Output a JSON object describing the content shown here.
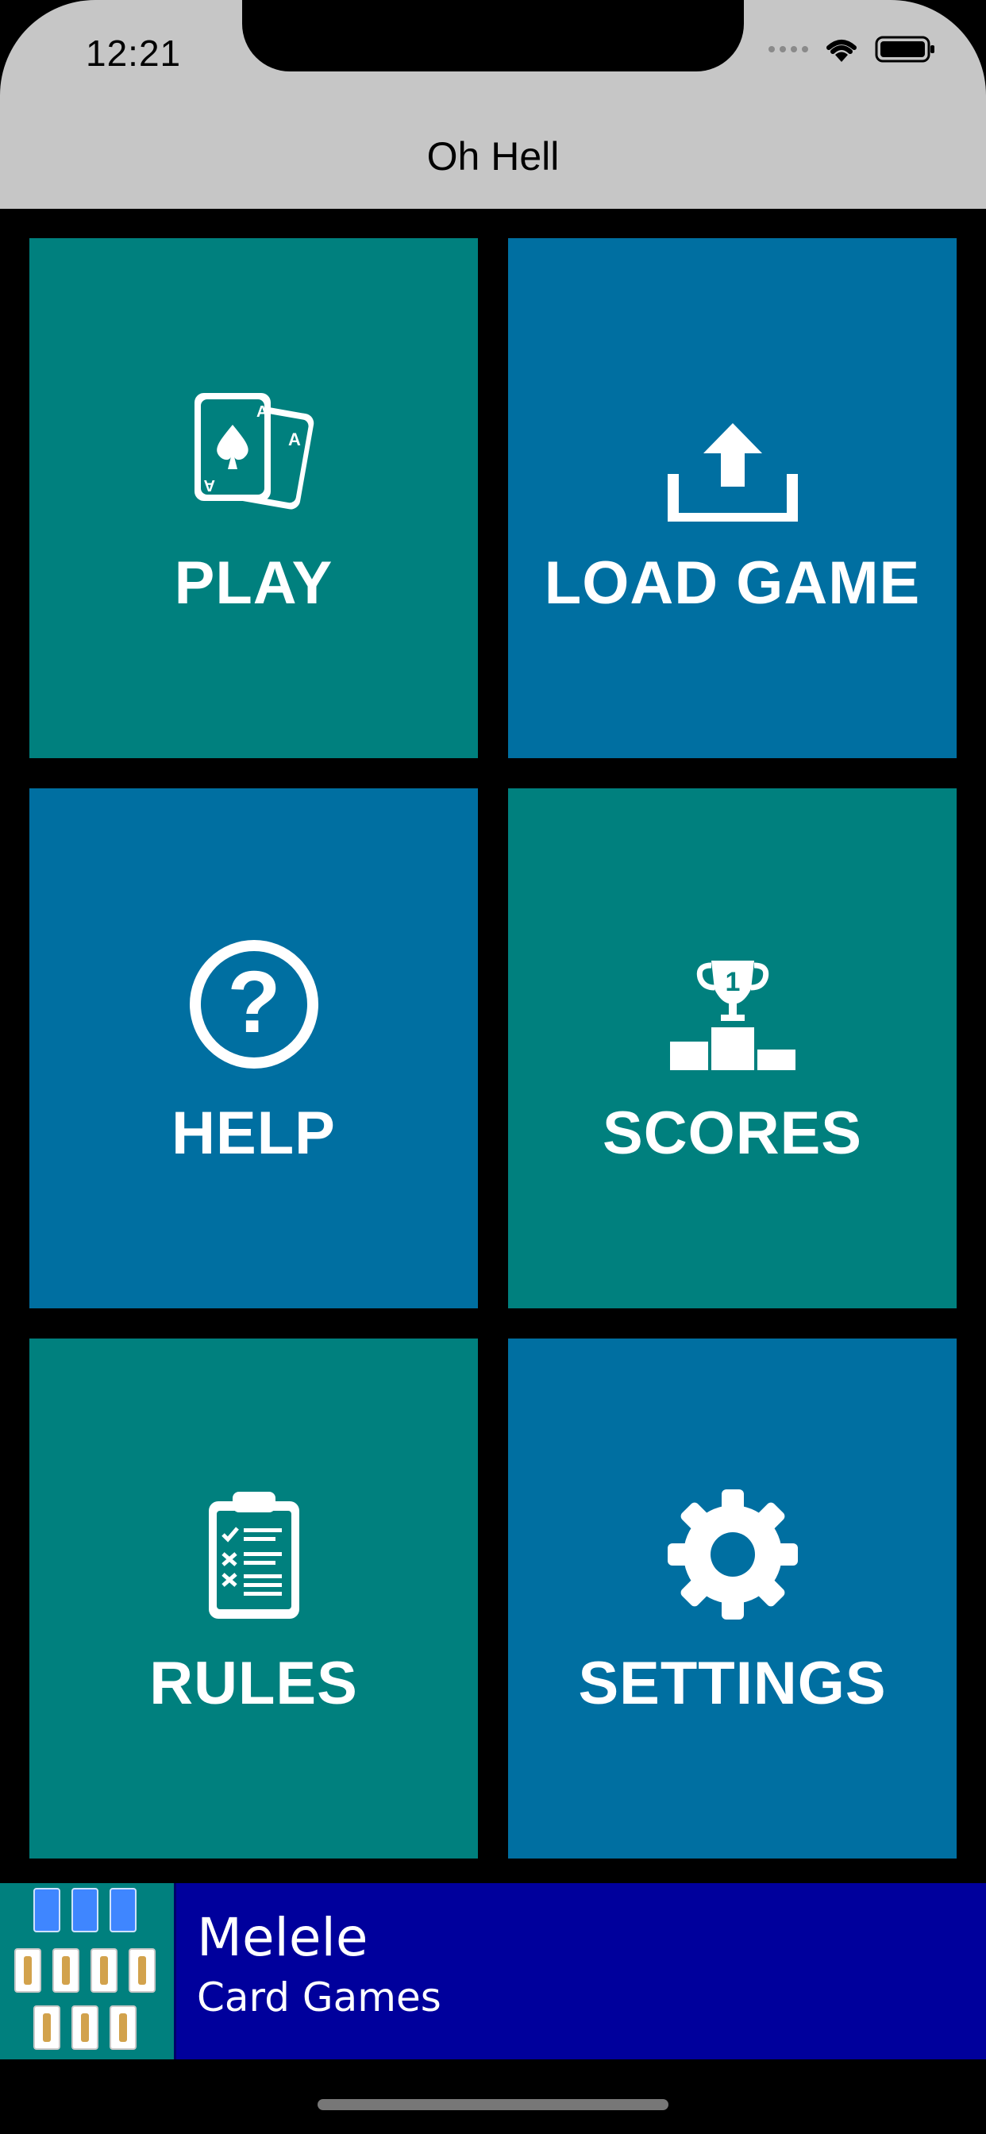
{
  "status_bar": {
    "time": "12:21"
  },
  "nav": {
    "title": "Oh Hell"
  },
  "tiles": [
    {
      "label": "PLAY",
      "icon": "cards-icon",
      "color": "#00807e"
    },
    {
      "label": "LOAD GAME",
      "icon": "upload-icon",
      "color": "#006fa1"
    },
    {
      "label": "HELP",
      "icon": "question-circle-icon",
      "color": "#006fa1"
    },
    {
      "label": "SCORES",
      "icon": "podium-trophy-icon",
      "color": "#00807e"
    },
    {
      "label": "RULES",
      "icon": "clipboard-checklist-icon",
      "color": "#00807e"
    },
    {
      "label": "SETTINGS",
      "icon": "gear-icon",
      "color": "#006fa1"
    }
  ],
  "ad": {
    "title": "Melele",
    "subtitle": "Card Games",
    "background": "#00009c"
  }
}
